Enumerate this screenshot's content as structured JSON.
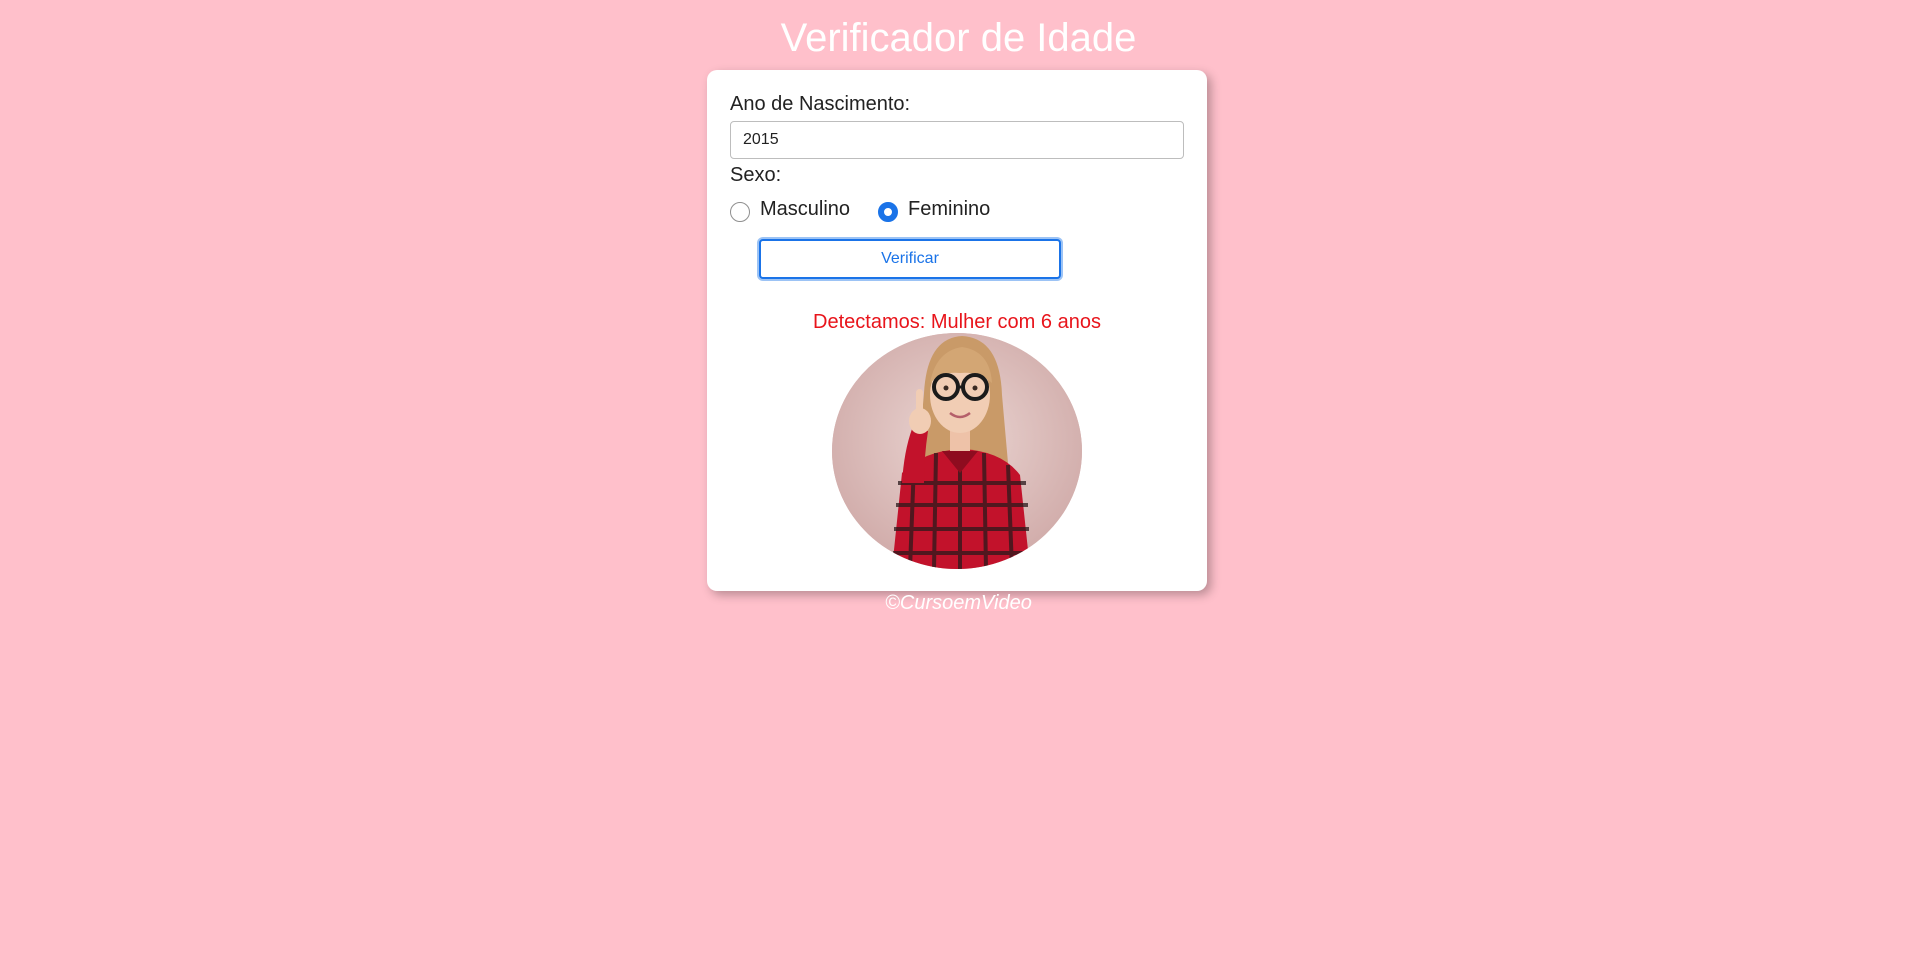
{
  "header": {
    "title": "Verificador de Idade"
  },
  "form": {
    "year_label": "Ano de Nascimento:",
    "year_value": "2015",
    "sex_label": "Sexo:",
    "sex_options": [
      {
        "label": "Masculino",
        "checked": false
      },
      {
        "label": "Feminino",
        "checked": true
      }
    ],
    "verify_label": "Verificar"
  },
  "result": {
    "text": "Detectamos: Mulher com 6 anos",
    "image": "girl-with-glasses-photo"
  },
  "footer": {
    "text": "©CursoemVideo"
  },
  "colors": {
    "background": "#ffc0cb",
    "accent": "#1a73e8",
    "result_text": "#e8141b"
  }
}
